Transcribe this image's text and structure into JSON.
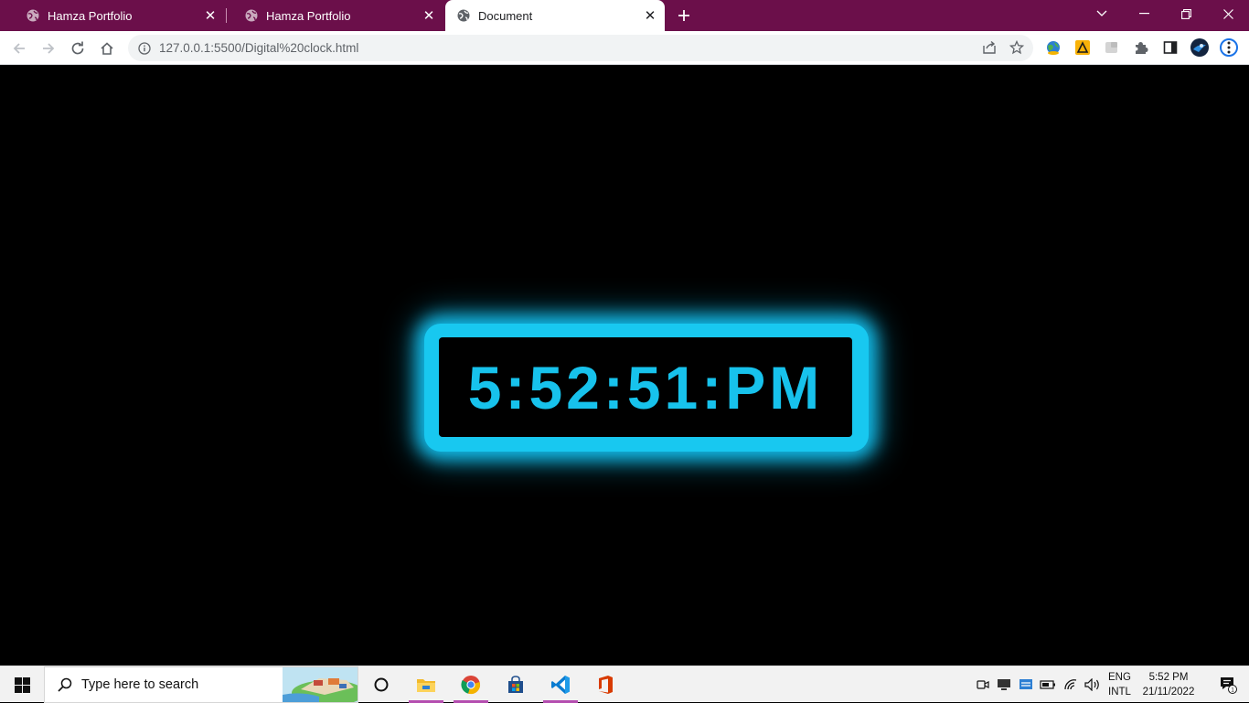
{
  "browser": {
    "tabs": [
      {
        "title": "Hamza Portfolio",
        "active": false
      },
      {
        "title": "Hamza Portfolio",
        "active": false
      },
      {
        "title": "Document",
        "active": true
      }
    ],
    "address": "127.0.0.1:5500/Digital%20clock.html",
    "colors": {
      "tabstrip": "#6b0f4a",
      "toolbar": "#ffffff"
    },
    "icons": {
      "tab_favicon": "globe-icon",
      "new_tab": "plus-icon",
      "window_controls": [
        "chevron-down-icon",
        "minimize-icon",
        "restore-icon",
        "close-icon"
      ],
      "nav": [
        "back-arrow-icon",
        "forward-arrow-icon",
        "reload-icon",
        "home-icon"
      ],
      "omnibox": [
        "info-icon",
        "share-icon",
        "star-icon"
      ],
      "extensions": [
        "globe-extension-icon",
        "warning-extension-icon",
        "grey-extension-icon",
        "puzzle-icon",
        "side-panel-icon",
        "profile-avatar",
        "more-menu-icon"
      ]
    }
  },
  "clock": {
    "time": "5:52:51:PM",
    "colors": {
      "text": "#17c2ec",
      "glow": "#13b9e6",
      "background": "#000000"
    }
  },
  "taskbar": {
    "search_placeholder": "Type here to search",
    "apps": [
      "windows-start-icon",
      "cortana-circle-icon",
      "file-explorer-icon",
      "chrome-icon",
      "microsoft-store-icon",
      "vscode-icon",
      "office-icon"
    ],
    "tray_icons": [
      "meet-now-icon",
      "desktop-icon",
      "network-share-icon",
      "battery-icon",
      "wifi-icon",
      "volume-icon"
    ],
    "language_line1": "ENG",
    "language_line2": "INTL",
    "time": "5:52 PM",
    "date": "21/11/2022",
    "notification_count": "1"
  }
}
